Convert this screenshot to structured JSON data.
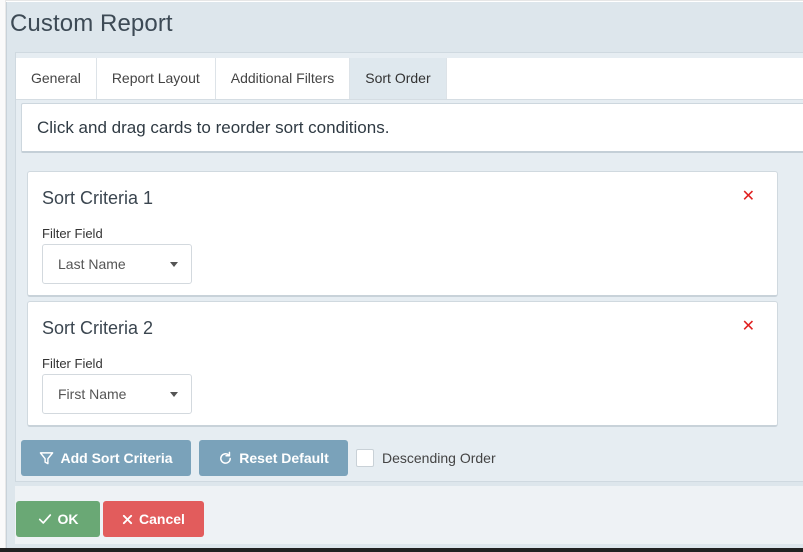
{
  "dialog": {
    "title": "Custom Report"
  },
  "tabs": [
    {
      "label": "General"
    },
    {
      "label": "Report Layout"
    },
    {
      "label": "Additional Filters"
    },
    {
      "label": "Sort Order",
      "active": true
    }
  ],
  "instructions": "Click and drag cards to reorder sort conditions.",
  "criteria": [
    {
      "title": "Sort Criteria 1",
      "field_label": "Filter Field",
      "value": "Last Name",
      "remove_icon": "close-icon"
    },
    {
      "title": "Sort Criteria 2",
      "field_label": "Filter Field",
      "value": "First Name",
      "remove_icon": "close-icon"
    }
  ],
  "actions": {
    "add_label": "Add Sort Criteria",
    "reset_label": "Reset Default",
    "descending_label": "Descending Order",
    "descending_checked": false
  },
  "footer": {
    "ok_label": "OK",
    "cancel_label": "Cancel"
  },
  "colors": {
    "accent_button": "#7aa2ba",
    "ok_button": "#6aa875",
    "cancel_button": "#e25c5c",
    "remove_icon": "#e02020"
  }
}
